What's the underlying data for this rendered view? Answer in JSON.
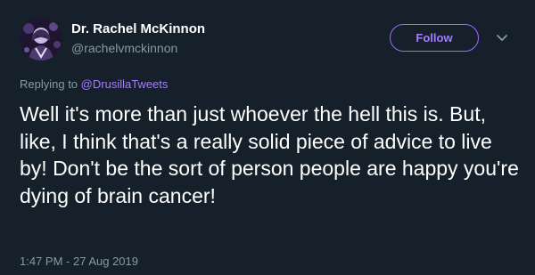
{
  "author": {
    "display_name": "Dr. Rachel McKinnon",
    "handle": "@rachelvmckinnon"
  },
  "follow_button": {
    "label": "Follow"
  },
  "menu": {
    "icon": "chevron-down-icon"
  },
  "reply_context": {
    "prefix": "Replying to",
    "mention": "@DrusillaTweets"
  },
  "tweet": {
    "text": "Well it's more than just whoever the hell this is. But, like, I think that's a really solid piece of advice to live by! Don't be the sort of person people are happy you're dying of brain cancer!",
    "timestamp": "1:47 PM - 27 Aug 2019"
  },
  "colors": {
    "background": "#15202b",
    "accent": "#a57bff",
    "secondary_text": "#8899a6"
  }
}
